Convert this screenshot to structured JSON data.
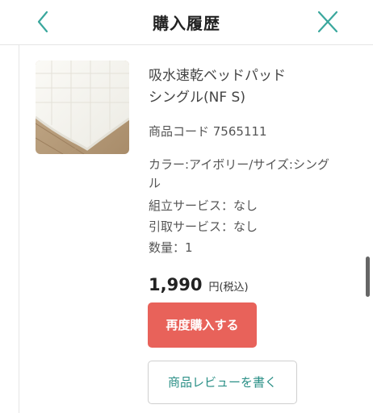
{
  "header": {
    "title": "購入履歴",
    "back_icon": "chevron-left-icon",
    "close_icon": "close-icon",
    "icon_color": "#3aa79d"
  },
  "product": {
    "image": "quilted-mattress-pad-thumbnail",
    "name_line1": "吸水速乾ベッドパッド",
    "name_line2": "シングル(NF S)",
    "code": "商品コード 7565111",
    "color_size": "カラー:アイボリー/サイズ:シングル",
    "assembly_service": "組立サービス：なし",
    "removal_service": "引取サービス：なし",
    "quantity": "数量：1",
    "price": "1,990",
    "price_unit": "円(税込)"
  },
  "actions": {
    "rebuy_label": "再度購入する",
    "review_label": "商品レビューを書く",
    "rebuy_color": "#e8625a",
    "review_text_color": "#2a8f86"
  }
}
